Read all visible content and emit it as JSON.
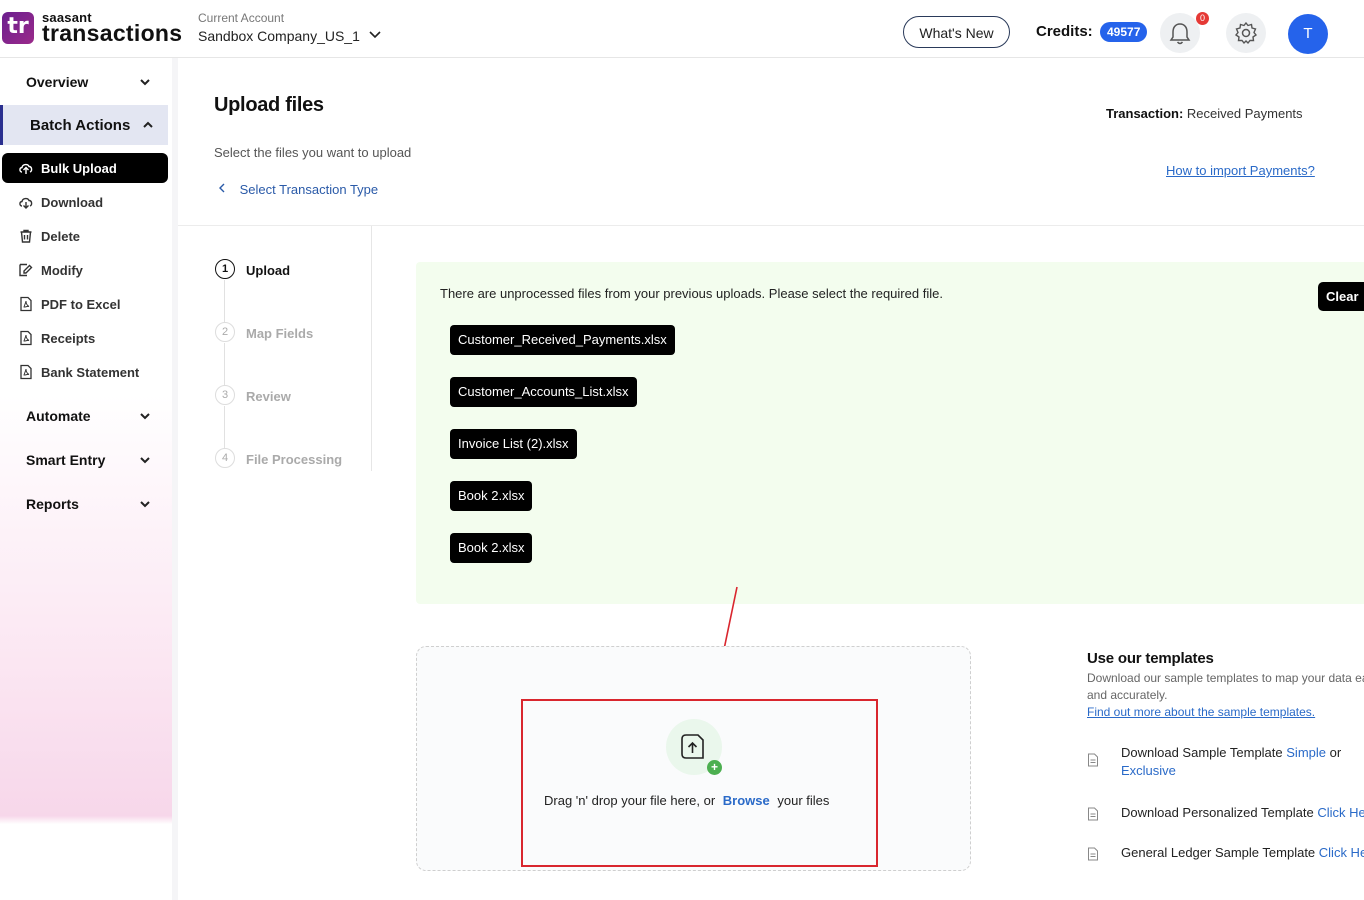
{
  "header": {
    "logo_badge": "tr",
    "logo_small": "saasant",
    "logo_big": "transactions",
    "account_label": "Current Account",
    "account_name": "Sandbox Company_US_1",
    "whats_new": "What's New",
    "credits_label": "Credits:",
    "credits_value": "49577",
    "notification_count": "0",
    "avatar_initial": "T"
  },
  "sidebar": {
    "overview": "Overview",
    "batch_actions": "Batch Actions",
    "items": [
      {
        "label": "Bulk Upload",
        "icon": "cloud-upload-icon"
      },
      {
        "label": "Download",
        "icon": "cloud-download-icon"
      },
      {
        "label": "Delete",
        "icon": "trash-icon"
      },
      {
        "label": "Modify",
        "icon": "edit-icon"
      },
      {
        "label": "PDF to Excel",
        "icon": "pdf-icon"
      },
      {
        "label": "Receipts",
        "icon": "pdf-icon"
      },
      {
        "label": "Bank Statement",
        "icon": "pdf-icon"
      }
    ],
    "automate": "Automate",
    "smart_entry": "Smart Entry",
    "reports": "Reports"
  },
  "main": {
    "title": "Upload files",
    "transaction_label": "Transaction:",
    "transaction_value": "Received Payments",
    "subtitle": "Select the files you want to upload",
    "back_link": "Select Transaction Type",
    "how_to_link": "How to import Payments?"
  },
  "steps": [
    {
      "num": "1",
      "label": "Upload"
    },
    {
      "num": "2",
      "label": "Map Fields"
    },
    {
      "num": "3",
      "label": "Review"
    },
    {
      "num": "4",
      "label": "File Processing"
    }
  ],
  "unprocessed": {
    "message": "There are unprocessed files from your previous uploads. Please select the required file.",
    "clear_label": "Clear",
    "files": [
      "Customer_Received_Payments.xlsx",
      "Customer_Accounts_List.xlsx",
      "Invoice List (2).xlsx",
      "Book 2.xlsx",
      "Book 2.xlsx"
    ]
  },
  "dropzone": {
    "text_before": "Drag 'n' drop your file here, or",
    "browse": "Browse",
    "text_after": "your files"
  },
  "templates": {
    "title": "Use our templates",
    "description": "Download our sample templates to map your data easily and accurately.",
    "find_more": "Find out more about the sample templates.",
    "row1_text": "Download Sample Template",
    "row1_link1": "Simple",
    "row1_or": "or",
    "row1_link2": "Exclusive",
    "row2_text": "Download Personalized Template",
    "row2_link": "Click Here",
    "row3_text": "General Ledger Sample Template",
    "row3_link": "Click Here"
  },
  "colors": {
    "accent": "#2563eb",
    "highlight_red": "#d9262e",
    "panel_green": "#f3fdee"
  }
}
